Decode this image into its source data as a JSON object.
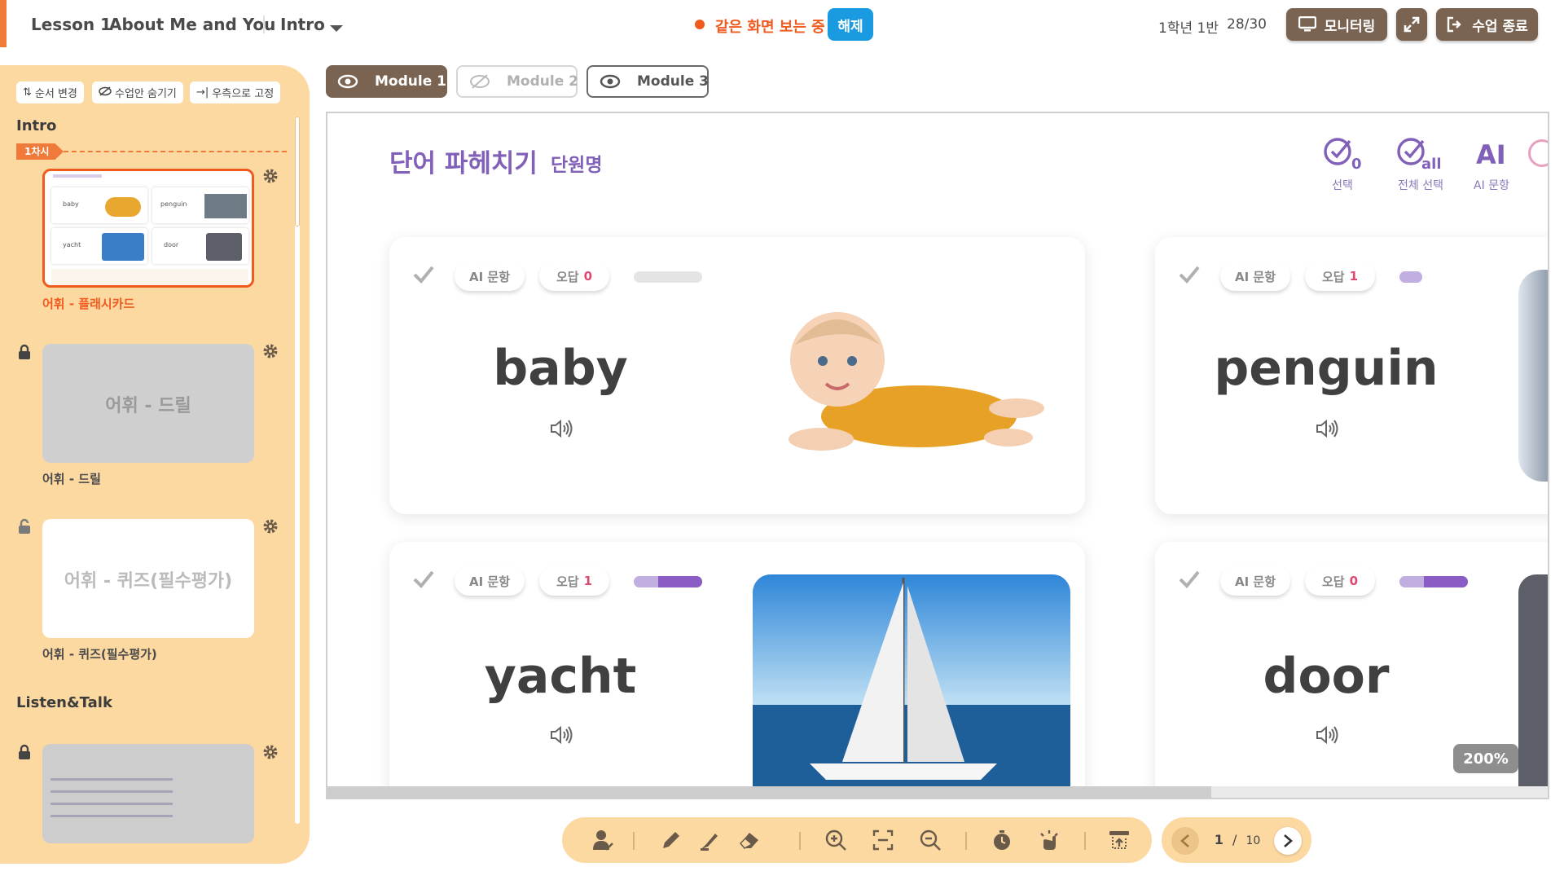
{
  "header": {
    "lesson_label": "Lesson 1",
    "lesson_title": "About Me and You",
    "section": "Intro",
    "live_status": "같은 화면 보는 중",
    "release_label": "해제",
    "class_name": "1학년 1반",
    "attendance": "28/30",
    "monitoring_label": "모니터링",
    "end_class_label": "수업 종료"
  },
  "sidebar": {
    "tools": [
      "순서 변경",
      "수업안 숨기기",
      "우측으로 고정"
    ],
    "sections": [
      "Intro",
      "Listen&Talk"
    ],
    "period_label": "1차시",
    "lessons": [
      {
        "caption": "어휘 - 플래시카드",
        "locked": false,
        "active": true
      },
      {
        "caption": "어휘 - 드릴",
        "placeholder": "어휘 - 드릴",
        "locked": true
      },
      {
        "caption": "어휘 - 퀴즈(필수평가)",
        "placeholder": "어휘 - 퀴즈(필수평가)",
        "locked": true
      }
    ],
    "thumb_words": [
      "baby",
      "penguin",
      "yacht",
      "door"
    ]
  },
  "modules": [
    {
      "label": "Module 1",
      "state": "active"
    },
    {
      "label": "Module 2",
      "state": "hidden"
    },
    {
      "label": "Module 3",
      "state": "normal"
    }
  ],
  "viewer": {
    "title": "단어 파헤치기",
    "unit": "단원명",
    "top_actions": [
      {
        "icon": "check-zero-icon",
        "label": "선택"
      },
      {
        "icon": "check-all-icon",
        "label": "전체 선택"
      },
      {
        "icon": "ai-icon",
        "label": "AI 문항"
      }
    ],
    "ai_pill": "AI 문항",
    "wrong_label": "오답",
    "cards": [
      {
        "word": "baby",
        "wrong": 0,
        "progress": 0.0
      },
      {
        "word": "penguin",
        "wrong": 1,
        "progress": 0.3
      },
      {
        "word": "yacht",
        "wrong": 1,
        "progress": 0.7
      },
      {
        "word": "door",
        "wrong": 0,
        "progress": 0.7
      }
    ],
    "zoom": "200%"
  },
  "pager": {
    "current": "1",
    "sep": "/",
    "total": "10"
  },
  "colors": {
    "accent": "#f07a3a",
    "purple": "#8060b8",
    "brown": "#7a6350",
    "sidebar": "#fdd9a2",
    "blue": "#1a9ae0"
  }
}
